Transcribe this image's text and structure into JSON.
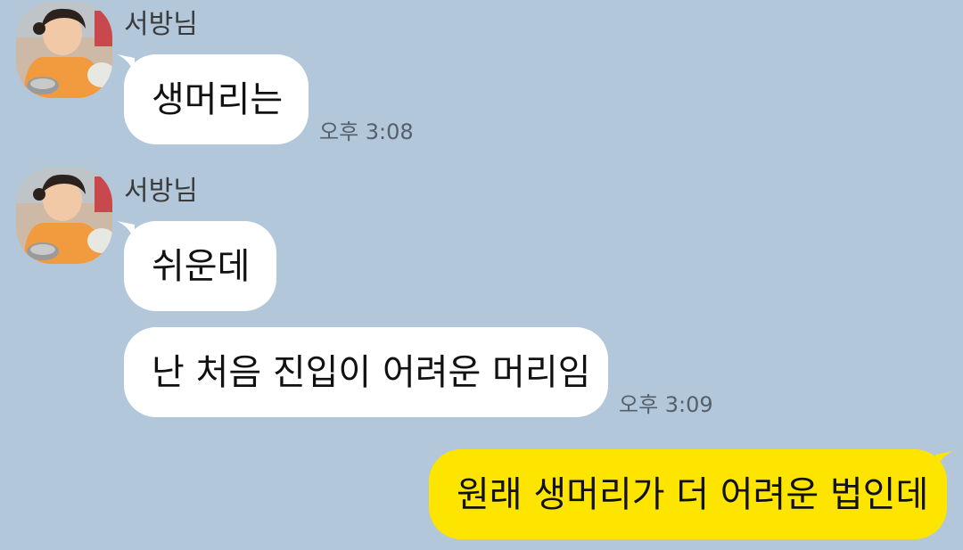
{
  "colors": {
    "background": "#b2c7da",
    "incoming_bubble": "#ffffff",
    "outgoing_bubble": "#fee500"
  },
  "messages": [
    {
      "sender": "서방님",
      "text": "생머리는",
      "time": "오후 3:08"
    },
    {
      "sender": "서방님",
      "text": "쉬운데"
    },
    {
      "text": "난 처음 진입이 어려운 머리임",
      "time": "오후 3:09"
    },
    {
      "text": "원래 생머리가 더 어려운 법인데"
    }
  ]
}
